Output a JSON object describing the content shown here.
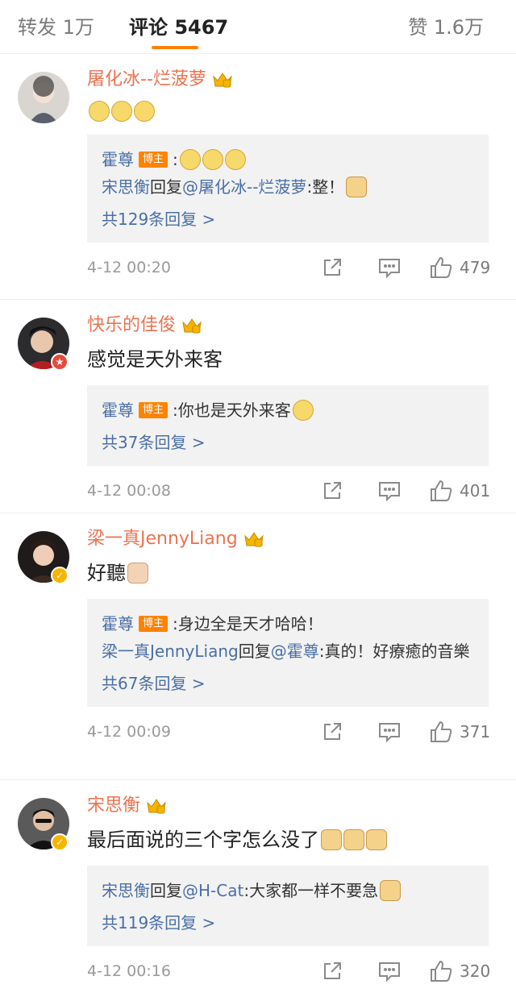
{
  "tabs": {
    "repost_label": "转发",
    "repost_count": "1万",
    "comment_label": "评论",
    "comment_count": "5467",
    "like_label": "赞",
    "like_count": "1.6万"
  },
  "colors": {
    "accent": "#ff8200",
    "username": "#eb7350",
    "link": "#4a6fa5",
    "reply_bg": "#f2f2f2"
  },
  "comments": [
    {
      "username": "屠化冰--烂菠萝",
      "text": "",
      "emoji_count": 3,
      "replies": [
        {
          "user": "霍尊",
          "tag": "博主",
          "sep": ":",
          "text": ""
        },
        {
          "user": "宋思衡",
          "mid": "回复",
          "target": "@屠化冰--烂菠萝",
          "sep": ":",
          "text": "整！"
        }
      ],
      "more": "共129条回复 >",
      "time": "4-12 00:20",
      "likes": "479"
    },
    {
      "username": "快乐的佳俊",
      "text": "感觉是天外来客",
      "replies": [
        {
          "user": "霍尊",
          "tag": "博主",
          "sep": ":",
          "text": "你也是天外来客"
        }
      ],
      "more": "共37条回复 >",
      "time": "4-12 00:08",
      "likes": "401"
    },
    {
      "username": "梁一真JennyLiang",
      "text": "好聽",
      "replies": [
        {
          "user": "霍尊",
          "tag": "博主",
          "sep": ":",
          "text": "身边全是天才哈哈！"
        },
        {
          "user": "梁一真JennyLiang",
          "mid": "回复",
          "target": "@霍尊",
          "sep": ":",
          "text": "真的！好療癒的音樂"
        }
      ],
      "more": "共67条回复 >",
      "time": "4-12 00:09",
      "likes": "371"
    },
    {
      "username": "宋思衡",
      "text": "最后面说的三个字怎么没了",
      "replies": [
        {
          "user": "宋思衡",
          "mid": "回复",
          "target": "@H-Cat",
          "sep": ":",
          "text": "大家都一样不要急"
        }
      ],
      "more": "共119条回复 >",
      "time": "4-12 00:16",
      "likes": "320"
    }
  ]
}
